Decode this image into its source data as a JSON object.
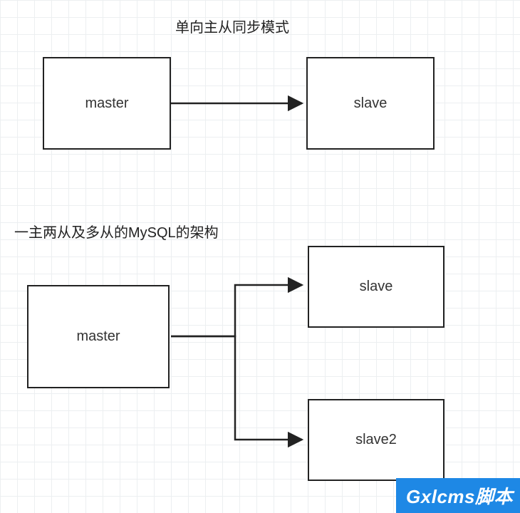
{
  "title1": "单向主从同步模式",
  "title2": "一主两从及多从的MySQL的架构",
  "box1_master": "master",
  "box1_slave": "slave",
  "box2_master": "master",
  "box2_slave1": "slave",
  "box2_slave2": "slave2",
  "watermark": "Gxlcms脚本",
  "chart_data": [
    {
      "type": "flow",
      "title": "单向主从同步模式",
      "nodes": [
        "master",
        "slave"
      ],
      "edges": [
        [
          "master",
          "slave"
        ]
      ]
    },
    {
      "type": "flow",
      "title": "一主两从及多从的MySQL的架构",
      "nodes": [
        "master",
        "slave",
        "slave2"
      ],
      "edges": [
        [
          "master",
          "slave"
        ],
        [
          "master",
          "slave2"
        ]
      ]
    }
  ]
}
